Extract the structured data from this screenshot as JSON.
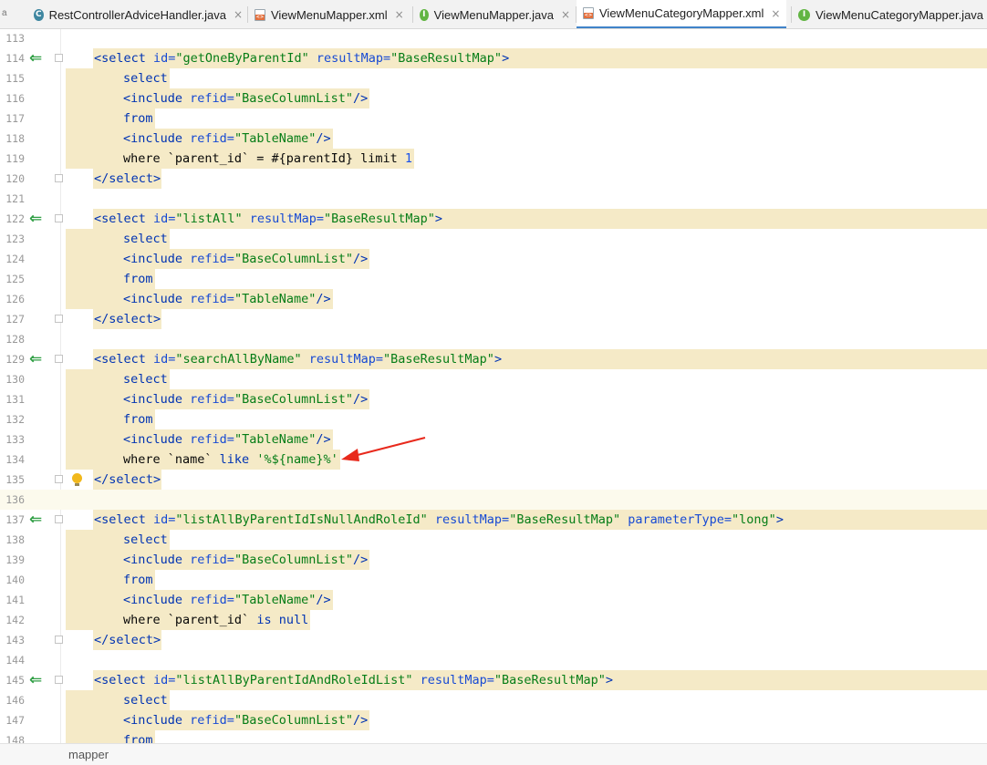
{
  "tabs": [
    {
      "label": "RestControllerAdviceHandler.java",
      "icon": "java-class-icon",
      "icon_letter": "C",
      "active": false
    },
    {
      "label": "ViewMenuMapper.xml",
      "icon": "xml-file-icon",
      "active": false
    },
    {
      "label": "ViewMenuMapper.java",
      "icon": "java-interface-icon",
      "icon_letter": "I",
      "active": false
    },
    {
      "label": "ViewMenuCategoryMapper.xml",
      "icon": "xml-file-icon",
      "active": true
    },
    {
      "label": "ViewMenuCategoryMapper.java",
      "icon": "java-interface-icon",
      "icon_letter": "I",
      "active": false
    }
  ],
  "tab_close_glyph": "×",
  "overflow_marker": "a",
  "editor": {
    "current_line": 136,
    "lines": [
      {
        "n": "113",
        "tokens": []
      },
      {
        "n": "114",
        "impl": true,
        "fold": true,
        "tokens": [
          [
            "t",
            "<select "
          ],
          [
            "a",
            "id="
          ],
          [
            "s",
            "\"getOneByParentId\" "
          ],
          [
            "a",
            "resultMap="
          ],
          [
            "s",
            "\"BaseResultMap\""
          ],
          [
            "t",
            ">"
          ]
        ]
      },
      {
        "n": "115",
        "tokens": [
          [
            "k",
            "select"
          ]
        ]
      },
      {
        "n": "116",
        "tokens": [
          [
            "t",
            "<include "
          ],
          [
            "a",
            "refid="
          ],
          [
            "s",
            "\"BaseColumnList\""
          ],
          [
            "t",
            "/>"
          ]
        ]
      },
      {
        "n": "117",
        "tokens": [
          [
            "k",
            "from"
          ]
        ]
      },
      {
        "n": "118",
        "tokens": [
          [
            "t",
            "<include "
          ],
          [
            "a",
            "refid="
          ],
          [
            "s",
            "\"TableName\""
          ],
          [
            "t",
            "/>"
          ]
        ]
      },
      {
        "n": "119",
        "tokens": [
          [
            "p",
            "where `parent_id` = #{parentId} limit "
          ],
          [
            "n",
            "1"
          ]
        ]
      },
      {
        "n": "120",
        "fold": true,
        "tokens": [
          [
            "t",
            "</select>"
          ]
        ]
      },
      {
        "n": "121",
        "tokens": []
      },
      {
        "n": "122",
        "impl": true,
        "fold": true,
        "tokens": [
          [
            "t",
            "<select "
          ],
          [
            "a",
            "id="
          ],
          [
            "s",
            "\"listAll\" "
          ],
          [
            "a",
            "resultMap="
          ],
          [
            "s",
            "\"BaseResultMap\""
          ],
          [
            "t",
            ">"
          ]
        ]
      },
      {
        "n": "123",
        "tokens": [
          [
            "k",
            "select"
          ]
        ]
      },
      {
        "n": "124",
        "tokens": [
          [
            "t",
            "<include "
          ],
          [
            "a",
            "refid="
          ],
          [
            "s",
            "\"BaseColumnList\""
          ],
          [
            "t",
            "/>"
          ]
        ]
      },
      {
        "n": "125",
        "tokens": [
          [
            "k",
            "from"
          ]
        ]
      },
      {
        "n": "126",
        "tokens": [
          [
            "t",
            "<include "
          ],
          [
            "a",
            "refid="
          ],
          [
            "s",
            "\"TableName\""
          ],
          [
            "t",
            "/>"
          ]
        ]
      },
      {
        "n": "127",
        "fold": true,
        "tokens": [
          [
            "t",
            "</select>"
          ]
        ]
      },
      {
        "n": "128",
        "tokens": []
      },
      {
        "n": "129",
        "impl": true,
        "fold": true,
        "tokens": [
          [
            "t",
            "<select "
          ],
          [
            "a",
            "id="
          ],
          [
            "s",
            "\"searchAllByName\" "
          ],
          [
            "a",
            "resultMap="
          ],
          [
            "s",
            "\"BaseResultMap\""
          ],
          [
            "t",
            ">"
          ]
        ]
      },
      {
        "n": "130",
        "tokens": [
          [
            "k",
            "select"
          ]
        ]
      },
      {
        "n": "131",
        "tokens": [
          [
            "t",
            "<include "
          ],
          [
            "a",
            "refid="
          ],
          [
            "s",
            "\"BaseColumnList\""
          ],
          [
            "t",
            "/>"
          ]
        ]
      },
      {
        "n": "132",
        "tokens": [
          [
            "k",
            "from"
          ]
        ]
      },
      {
        "n": "133",
        "tokens": [
          [
            "t",
            "<include "
          ],
          [
            "a",
            "refid="
          ],
          [
            "s",
            "\"TableName\""
          ],
          [
            "t",
            "/>"
          ]
        ]
      },
      {
        "n": "134",
        "tokens": [
          [
            "p",
            "where `name` "
          ],
          [
            "k",
            "like "
          ],
          [
            "s",
            "'%${name}%'"
          ]
        ]
      },
      {
        "n": "135",
        "fold": true,
        "bulb": true,
        "tokens": [
          [
            "t",
            "</select>"
          ]
        ]
      },
      {
        "n": "136",
        "tokens": []
      },
      {
        "n": "137",
        "impl": true,
        "fold": true,
        "tokens": [
          [
            "t",
            "<select "
          ],
          [
            "a",
            "id="
          ],
          [
            "s",
            "\"listAllByParentIdIsNullAndRoleId\" "
          ],
          [
            "a",
            "resultMap="
          ],
          [
            "s",
            "\"BaseResultMap\" "
          ],
          [
            "a",
            "parameterType="
          ],
          [
            "s",
            "\"long\""
          ],
          [
            "t",
            ">"
          ]
        ]
      },
      {
        "n": "138",
        "tokens": [
          [
            "k",
            "select"
          ]
        ]
      },
      {
        "n": "139",
        "tokens": [
          [
            "t",
            "<include "
          ],
          [
            "a",
            "refid="
          ],
          [
            "s",
            "\"BaseColumnList\""
          ],
          [
            "t",
            "/>"
          ]
        ]
      },
      {
        "n": "140",
        "tokens": [
          [
            "k",
            "from"
          ]
        ]
      },
      {
        "n": "141",
        "tokens": [
          [
            "t",
            "<include "
          ],
          [
            "a",
            "refid="
          ],
          [
            "s",
            "\"TableName\""
          ],
          [
            "t",
            "/>"
          ]
        ]
      },
      {
        "n": "142",
        "tokens": [
          [
            "p",
            "where `parent_id` "
          ],
          [
            "k",
            "is null"
          ]
        ]
      },
      {
        "n": "143",
        "fold": true,
        "tokens": [
          [
            "t",
            "</select>"
          ]
        ]
      },
      {
        "n": "144",
        "tokens": []
      },
      {
        "n": "145",
        "impl": true,
        "fold": true,
        "tokens": [
          [
            "t",
            "<select "
          ],
          [
            "a",
            "id="
          ],
          [
            "s",
            "\"listAllByParentIdAndRoleIdList\" "
          ],
          [
            "a",
            "resultMap="
          ],
          [
            "s",
            "\"BaseResultMap\""
          ],
          [
            "t",
            ">"
          ]
        ]
      },
      {
        "n": "146",
        "tokens": [
          [
            "k",
            "select"
          ]
        ]
      },
      {
        "n": "147",
        "tokens": [
          [
            "t",
            "<include "
          ],
          [
            "a",
            "refid="
          ],
          [
            "s",
            "\"BaseColumnList\""
          ],
          [
            "t",
            "/>"
          ]
        ]
      },
      {
        "n": "148",
        "tokens": [
          [
            "k",
            "from"
          ]
        ]
      }
    ]
  },
  "implement_glyph": "⇐",
  "breadcrumb": "mapper",
  "colors": {
    "annotation_arrow": "#e8291c",
    "tag": "#0033b3",
    "string": "#067d17",
    "highlight": "#f5eac7"
  }
}
